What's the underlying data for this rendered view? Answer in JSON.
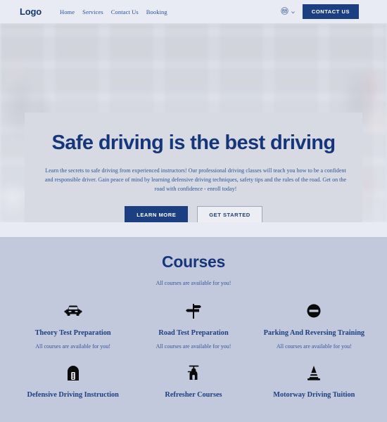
{
  "colors": {
    "brand_navy": "#1b3f80",
    "heading_navy": "#17367a",
    "body_blue": "#33549a",
    "page_bg": "#e8ebf3",
    "hero_card_bg": "#d7dae3",
    "courses_bg": "#c3c9dc",
    "button_text": "#ffffff"
  },
  "header": {
    "logo": "Logo",
    "nav": [
      {
        "label": "Home"
      },
      {
        "label": "Services"
      },
      {
        "label": "Contact Us"
      },
      {
        "label": "Booking"
      }
    ],
    "mail_icon": "mail-circle-icon",
    "chevron_icon": "chevron-down-icon",
    "cta_label": "CONTACT US"
  },
  "hero": {
    "background_icon": "tire-shop-motorcycle-photo",
    "title": "Safe driving is the best driving",
    "paragraph": "Learn the secrets to safe driving from experienced instructors! Our professional driving classes will teach you how to be a confident and responsible driver. Gain peace of mind by learning defensive driving techniques, safety tips and the rules of the road. Get on the road with confidence - enroll today!",
    "primary_button": "LEARN MORE",
    "secondary_button": "GET STARTED"
  },
  "courses": {
    "title": "Courses",
    "subtitle": "All courses are available for you!",
    "items": [
      {
        "icon": "car-front-icon",
        "name": "Theory Test Preparation",
        "desc": "All courses are available for you!"
      },
      {
        "icon": "signpost-icon",
        "name": "Road Test Preparation",
        "desc": "All courses are available for you!"
      },
      {
        "icon": "no-entry-sign-icon",
        "name": "Parking And Reversing Training",
        "desc": "All courses are available for you!"
      },
      {
        "icon": "traffic-light-tunnel-icon",
        "name": "Defensive Driving Instruction",
        "desc": ""
      },
      {
        "icon": "scooter-icon",
        "name": "Refresher Courses",
        "desc": ""
      },
      {
        "icon": "traffic-cone-icon",
        "name": "Motorway Driving Tuition",
        "desc": ""
      }
    ]
  }
}
